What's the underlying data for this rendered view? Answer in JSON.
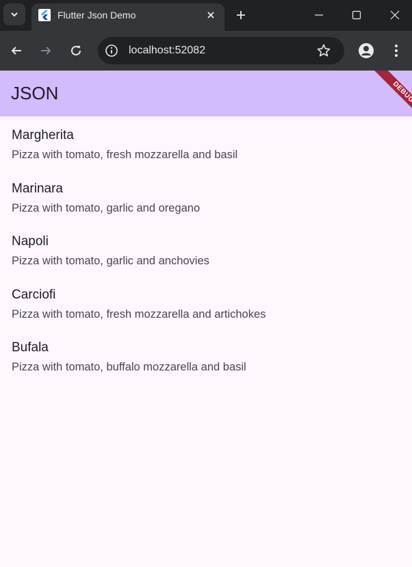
{
  "browser": {
    "tab_title": "Flutter Json Demo",
    "url": "localhost:52082"
  },
  "app": {
    "title": "JSON",
    "debug_label": "DEBUG",
    "appbar_color": "#d2bcfd",
    "background_color": "#fef7ff",
    "pizzas": [
      {
        "name": "Margherita",
        "description": "Pizza with tomato, fresh mozzarella and basil"
      },
      {
        "name": "Marinara",
        "description": "Pizza with tomato, garlic and oregano"
      },
      {
        "name": "Napoli",
        "description": "Pizza with tomato, garlic and anchovies"
      },
      {
        "name": "Carciofi",
        "description": "Pizza with tomato, fresh mozzarella and artichokes"
      },
      {
        "name": "Bufala",
        "description": "Pizza with tomato, buffalo mozzarella and basil"
      }
    ]
  },
  "icons": {
    "tab_search": "chevron-down-icon",
    "favicon": "flutter-logo-icon",
    "tab_close": "close-icon",
    "new_tab": "plus-icon",
    "minimize": "minimize-icon",
    "maximize": "maximize-icon",
    "close_window": "close-icon",
    "back": "arrow-left-icon",
    "forward": "arrow-right-icon",
    "reload": "reload-icon",
    "site_info": "info-icon",
    "bookmark": "star-icon",
    "profile": "person-icon",
    "menu": "kebab-menu-icon"
  }
}
